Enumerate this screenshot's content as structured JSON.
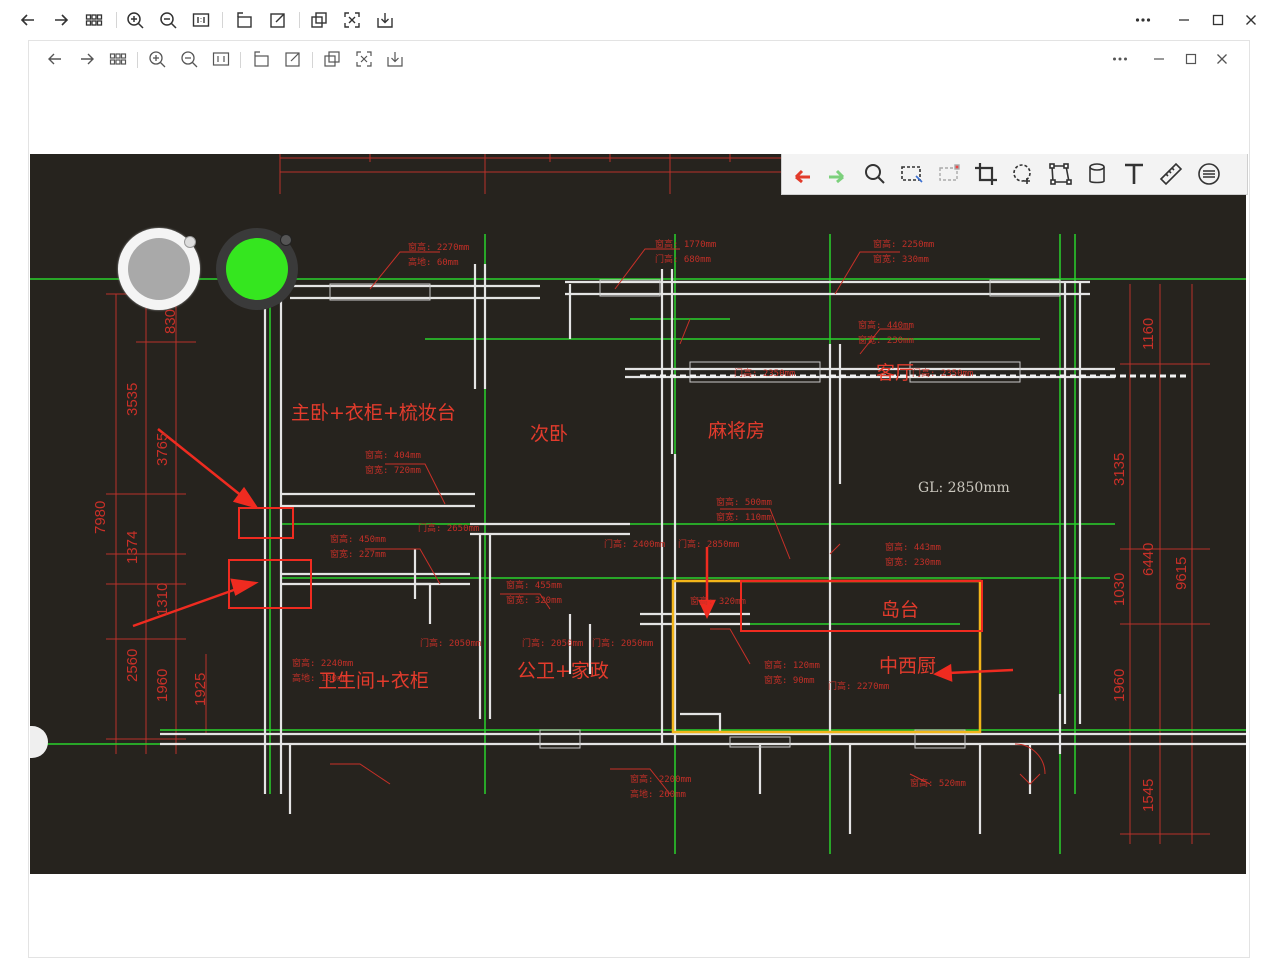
{
  "window": {
    "outer_toolbar_icons": [
      "back-icon",
      "forward-icon",
      "grid-icon",
      "zoom-in-icon",
      "zoom-out-icon",
      "actual-size-icon",
      "rotate-icon",
      "edit-icon",
      "copy-icon",
      "fit-icon",
      "save-icon"
    ],
    "controls": [
      "more-icon",
      "minimize-icon",
      "maximize-icon",
      "close-icon"
    ]
  },
  "annotation_toolbar": {
    "tools": [
      "undo-icon",
      "redo-icon",
      "search-icon",
      "rect-select-icon",
      "region-icon",
      "crop-icon",
      "lasso-icon",
      "transform-icon",
      "cylinder-icon",
      "text-icon",
      "ruler-icon",
      "more-icon"
    ],
    "undo_color": "#e23b2b",
    "redo_color": "#7cd07c"
  },
  "knobs": {
    "left_color": "#a9a9a9",
    "right_color": "#35e61f"
  },
  "floorplan": {
    "rooms": {
      "master_bedroom": "主卧+衣柜+梳妆台",
      "second_bedroom": "次卧",
      "mahjong_room": "麻将房",
      "living_room": "客厅",
      "bathroom": "卫生间+衣柜",
      "public_wc": "公卫+家政",
      "island": "岛台",
      "kitchen": "中西厨"
    },
    "ceiling_height": "GL: 2850mm",
    "dims_left": [
      "7980",
      "3535",
      "3765",
      "1374",
      "1310",
      "2560",
      "1960",
      "1925",
      "830"
    ],
    "dims_right": [
      "1160",
      "3135",
      "6440",
      "9615",
      "1030",
      "1960",
      "1545"
    ],
    "notes": [
      "窗高: 2270mm",
      "高地: 60mm",
      "窗高: 1770mm",
      "门高: 680mm",
      "窗高: 2250mm",
      "窗宽: 330mm",
      "窗高: 440mm",
      "窗宽: 230mm",
      "门高: 2350mm",
      "门高: 2350mm",
      "窗高: 404mm",
      "窗宽: 720mm",
      "门高: 2650mm",
      "窗高: 450mm",
      "窗宽: 227mm",
      "门高: 2400mm",
      "门高: 2850mm",
      "窗高: 500mm",
      "窗宽: 110mm",
      "窗高: 443mm",
      "窗宽: 230mm",
      "窗高: 455mm",
      "窗宽: 320mm",
      "窗高: 320mm",
      "门高: 2050mm",
      "门高: 2050mm",
      "门高: 2050mm",
      "窗高: 2240mm",
      "高地: 100mm",
      "窗高: 120mm",
      "窗宽: 90mm",
      "门高: 2270mm",
      "窗高: 2200mm",
      "高地: 260mm",
      "窗高: 520mm"
    ]
  }
}
